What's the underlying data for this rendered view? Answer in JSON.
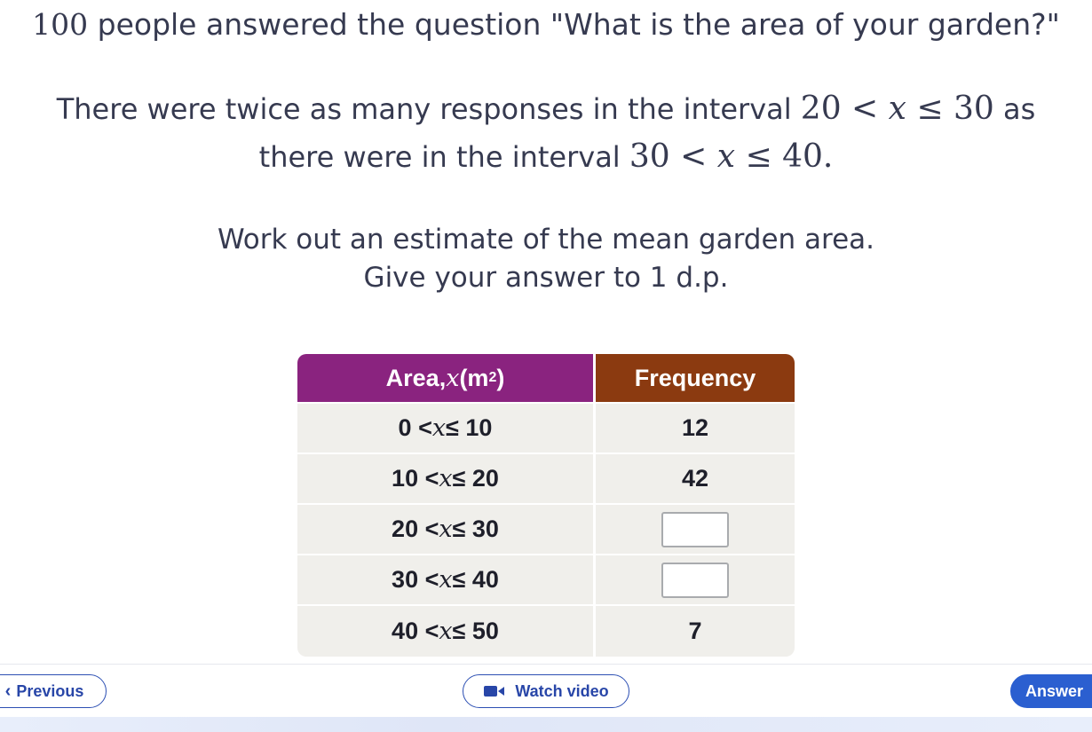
{
  "question": {
    "line1_num": "100",
    "line1_text": " people answered the question \"What is the area of your garden?\"",
    "line2_text": "There were twice as many responses in the interval ",
    "line2_math_a": "20 < ",
    "line2_math_var": "x",
    "line2_math_b": " ≤ 30",
    "line2_tail": " as",
    "line3_text": "there were in the interval ",
    "line3_math_a": "30 < ",
    "line3_math_var": "x",
    "line3_math_b": " ≤ 40.",
    "line4": "Work out an estimate of the mean garden area.",
    "line5": "Give your answer to 1 d.p."
  },
  "table": {
    "header_area": "Area, ",
    "header_var": "x",
    "header_unit_open": " (m",
    "header_unit_sup": "2",
    "header_unit_close": ")",
    "header_frequency": "Frequency",
    "rows": [
      {
        "lower": "0 < ",
        "var": "x",
        "upper": " ≤ 10",
        "frequency": "12"
      },
      {
        "lower": "10 < ",
        "var": "x",
        "upper": " ≤ 20",
        "frequency": "42"
      },
      {
        "lower": "20 < ",
        "var": "x",
        "upper": " ≤ 30",
        "frequency": ""
      },
      {
        "lower": "30 < ",
        "var": "x",
        "upper": " ≤ 40",
        "frequency": ""
      },
      {
        "lower": "40 < ",
        "var": "x",
        "upper": " ≤ 50",
        "frequency": "7"
      }
    ]
  },
  "nav": {
    "previous_label": "Previous",
    "video_label": "Watch video",
    "answer_label": "Answer"
  },
  "colors": {
    "header_area_bg": "#8a237f",
    "header_freq_bg": "#8b3a10",
    "cell_bg": "#f0efeb",
    "accent_blue": "#2b5fd0"
  },
  "icons": {
    "previous": "chevron-left-icon",
    "video": "video-camera-icon"
  }
}
